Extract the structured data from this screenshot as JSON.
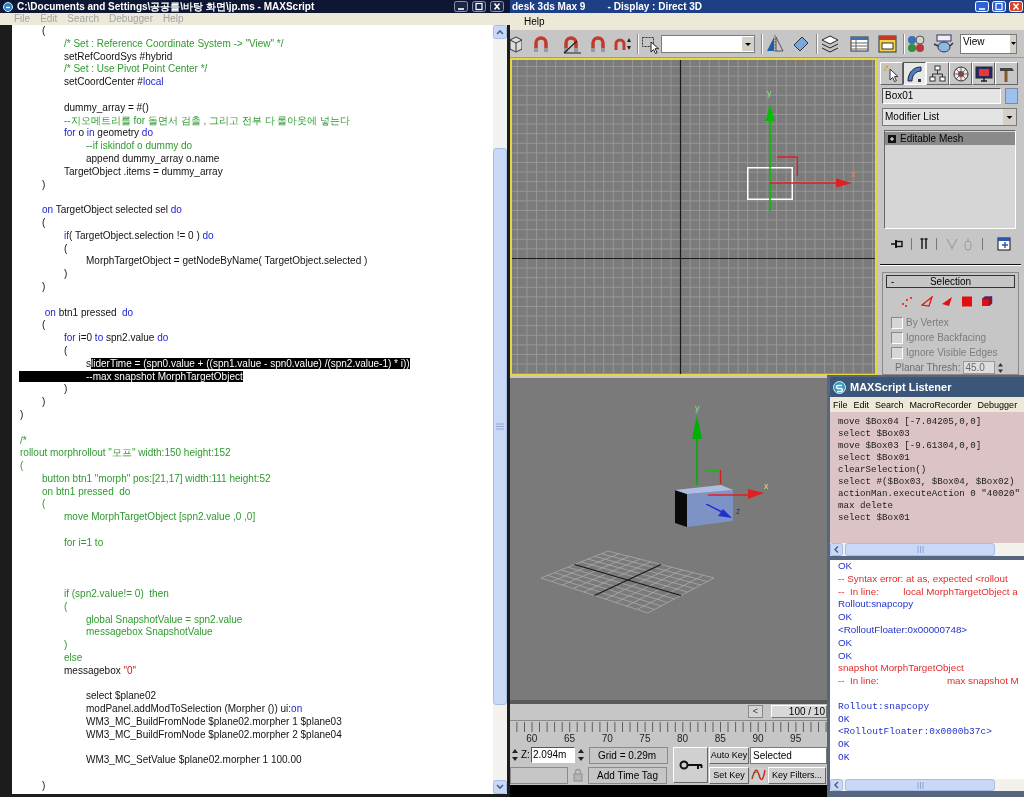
{
  "editor": {
    "title": "C:\\Documents and Settings\\공공를\\바탕 화면\\jp.ms - MAXScript",
    "menu": [
      {
        "label": "File",
        "disabled": true
      },
      {
        "label": "Edit",
        "disabled": true
      },
      {
        "label": "Search",
        "disabled": true
      },
      {
        "label": "Debugger",
        "disabled": true
      },
      {
        "label": "Help",
        "disabled": true
      }
    ],
    "lines": [
      {
        "kind": "code",
        "segments": [
          {
            "text": "\t(",
            "kind": "plain"
          }
        ]
      },
      {
        "kind": "code",
        "segments": [
          {
            "text": "\t\t/* Set : Reference Coordinate System -> \"View\" */",
            "kind": "comment"
          }
        ]
      },
      {
        "kind": "code",
        "segments": [
          {
            "text": "\t\tsetRefCoordSys #hybrid",
            "kind": "plain"
          }
        ]
      },
      {
        "kind": "code",
        "segments": [
          {
            "text": "\t\t/* Set : Use Pivot Point Center */",
            "kind": "comment"
          }
        ]
      },
      {
        "kind": "code",
        "segments": [
          {
            "text": "\t\tsetCoordCenter #",
            "kind": "plain"
          },
          {
            "text": "local",
            "kind": "keyword"
          }
        ]
      },
      {
        "kind": "blank"
      },
      {
        "kind": "code",
        "segments": [
          {
            "text": "\t\tdummy_array = #()",
            "kind": "plain"
          }
        ]
      },
      {
        "kind": "code",
        "segments": [
          {
            "text": "\t\t--지오메트리를 for 돌면서 검출 , 그리고 전부 다 롤아웃에 넣는다",
            "kind": "comment"
          }
        ]
      },
      {
        "kind": "code",
        "segments": [
          {
            "text": "\t\tfor",
            "kind": "keyword"
          },
          {
            "text": " o ",
            "kind": "plain"
          },
          {
            "text": "in",
            "kind": "keyword"
          },
          {
            "text": " geometry ",
            "kind": "plain"
          },
          {
            "text": "do",
            "kind": "keyword"
          }
        ]
      },
      {
        "kind": "code",
        "segments": [
          {
            "text": "\t\t\t--if iskindof o dummy do",
            "kind": "comment"
          }
        ]
      },
      {
        "kind": "code",
        "segments": [
          {
            "text": "\t\t\tappend dummy_array o.name",
            "kind": "plain"
          }
        ]
      },
      {
        "kind": "code",
        "segments": [
          {
            "text": "\t\tTargetObject .items = dummy_array",
            "kind": "plain"
          }
        ]
      },
      {
        "kind": "code",
        "segments": [
          {
            "text": "\t)",
            "kind": "plain"
          }
        ]
      },
      {
        "kind": "blank"
      },
      {
        "kind": "code",
        "segments": [
          {
            "text": "\ton",
            "kind": "keyword"
          },
          {
            "text": " TargetObject selected sel ",
            "kind": "plain"
          },
          {
            "text": "do",
            "kind": "keyword"
          }
        ]
      },
      {
        "kind": "code",
        "segments": [
          {
            "text": "\t(",
            "kind": "plain"
          }
        ]
      },
      {
        "kind": "code",
        "segments": [
          {
            "text": "\t\tif",
            "kind": "keyword"
          },
          {
            "text": "( TargetObject.selection != 0 ) ",
            "kind": "plain"
          },
          {
            "text": "do",
            "kind": "keyword"
          }
        ]
      },
      {
        "kind": "code",
        "segments": [
          {
            "text": "\t\t(",
            "kind": "plain"
          }
        ]
      },
      {
        "kind": "code",
        "segments": [
          {
            "text": "\t\t\tMorphTargetObject = getNodeByName( TargetObject.selected )",
            "kind": "plain"
          }
        ]
      },
      {
        "kind": "code",
        "segments": [
          {
            "text": "\t\t)",
            "kind": "plain"
          }
        ]
      },
      {
        "kind": "code",
        "segments": [
          {
            "text": "\t)",
            "kind": "plain"
          }
        ]
      },
      {
        "kind": "blank"
      },
      {
        "kind": "code",
        "segments": [
          {
            "text": "\t on",
            "kind": "keyword"
          },
          {
            "text": " btn1 pressed  ",
            "kind": "plain"
          },
          {
            "text": "do",
            "kind": "keyword"
          }
        ]
      },
      {
        "kind": "code",
        "segments": [
          {
            "text": "\t(",
            "kind": "plain"
          }
        ]
      },
      {
        "kind": "code",
        "segments": [
          {
            "text": "\t\tfor",
            "kind": "keyword"
          },
          {
            "text": " i=0 ",
            "kind": "plain"
          },
          {
            "text": "to",
            "kind": "keyword"
          },
          {
            "text": " spn2.value ",
            "kind": "plain"
          },
          {
            "text": "do",
            "kind": "keyword"
          }
        ]
      },
      {
        "kind": "code",
        "segments": [
          {
            "text": "\t\t(",
            "kind": "plain"
          }
        ]
      },
      {
        "kind": "code",
        "segments": [
          {
            "text": "\t\t\ts",
            "kind": "plain"
          },
          {
            "text": "liderTime = (spn0.value + ((spn1.value - spn0.value) /(spn2.value-1) * i))",
            "kind": "selection"
          }
        ]
      },
      {
        "kind": "code",
        "segments": [
          {
            "text": "\t\t\t--max snapshot MorphTargetObject",
            "kind": "selection"
          }
        ]
      },
      {
        "kind": "code",
        "segments": [
          {
            "text": "\t\t)",
            "kind": "plain"
          }
        ]
      },
      {
        "kind": "code",
        "segments": [
          {
            "text": "\t)",
            "kind": "plain"
          }
        ]
      },
      {
        "kind": "code",
        "segments": [
          {
            "text": ")",
            "kind": "plain"
          }
        ]
      },
      {
        "kind": "blank"
      },
      {
        "kind": "code",
        "segments": [
          {
            "text": "/*",
            "kind": "comment"
          }
        ]
      },
      {
        "kind": "code",
        "segments": [
          {
            "text": "rollout morphrollout \"모프\" width:150 height:152",
            "kind": "comment"
          }
        ]
      },
      {
        "kind": "code",
        "segments": [
          {
            "text": "(",
            "kind": "comment"
          }
        ]
      },
      {
        "kind": "code",
        "segments": [
          {
            "text": "\tbutton btn1 \"morph\" pos:[21,17] width:111 height:52",
            "kind": "comment"
          }
        ]
      },
      {
        "kind": "code",
        "segments": [
          {
            "text": "\ton btn1 pressed  do",
            "kind": "comment"
          }
        ]
      },
      {
        "kind": "code",
        "segments": [
          {
            "text": "\t(",
            "kind": "comment"
          }
        ]
      },
      {
        "kind": "code",
        "segments": [
          {
            "text": "\t\tmove MorphTargetObject [spn2.value ,0 ,0]",
            "kind": "comment"
          }
        ]
      },
      {
        "kind": "blank"
      },
      {
        "kind": "code",
        "segments": [
          {
            "text": "\t\tfor i=1 to",
            "kind": "comment"
          }
        ]
      },
      {
        "kind": "blank"
      },
      {
        "kind": "blank"
      },
      {
        "kind": "blank"
      },
      {
        "kind": "code",
        "segments": [
          {
            "text": "\t\tif (spn2.value!= 0)  then",
            "kind": "comment"
          }
        ]
      },
      {
        "kind": "code",
        "segments": [
          {
            "text": "\t\t(",
            "kind": "comment"
          }
        ]
      },
      {
        "kind": "code",
        "segments": [
          {
            "text": "\t\t\tglobal SnapshotValue = spn2.value",
            "kind": "comment"
          }
        ]
      },
      {
        "kind": "code",
        "segments": [
          {
            "text": "\t\t\tmessagebox SnapshotValue",
            "kind": "comment"
          }
        ]
      },
      {
        "kind": "code",
        "segments": [
          {
            "text": "\t\t)",
            "kind": "comment"
          }
        ]
      },
      {
        "kind": "code",
        "segments": [
          {
            "text": "\t\telse",
            "kind": "comment"
          }
        ]
      },
      {
        "kind": "code",
        "segments": [
          {
            "text": "\t\tmessagebox ",
            "kind": "plain"
          },
          {
            "text": "\"0\"",
            "kind": "string"
          }
        ]
      },
      {
        "kind": "blank"
      },
      {
        "kind": "code",
        "segments": [
          {
            "text": "\t\t\tselect $plane02",
            "kind": "plain"
          }
        ]
      },
      {
        "kind": "code",
        "segments": [
          {
            "text": "\t\t\tmodPanel.addModToSelection (Morpher ()) ui:",
            "kind": "plain"
          },
          {
            "text": "on",
            "kind": "keyword"
          }
        ]
      },
      {
        "kind": "code",
        "segments": [
          {
            "text": "\t\t\tWM3_MC_BuildFromNode $plane02.morpher 1 $plane03",
            "kind": "plain"
          }
        ]
      },
      {
        "kind": "code",
        "segments": [
          {
            "text": "\t\t\tWM3_MC_BuildFromNode $plane02.morpher 2 $plane04",
            "kind": "plain"
          }
        ]
      },
      {
        "kind": "blank"
      },
      {
        "kind": "code",
        "segments": [
          {
            "text": "\t\t\tWM3_MC_SetValue $plane02.morpher 1 100.00",
            "kind": "plain"
          }
        ]
      },
      {
        "kind": "blank"
      },
      {
        "kind": "code",
        "segments": [
          {
            "text": "\t)",
            "kind": "plain"
          }
        ]
      }
    ]
  },
  "app": {
    "title": "desk 3ds Max 9        - Display : Direct 3D",
    "menu": [
      {
        "label": "Help"
      }
    ],
    "toolbar": {
      "view_dropdown": "View"
    },
    "viewports": [
      {
        "kind": "top",
        "axis_labels": [
          "y",
          "x"
        ]
      },
      {
        "kind": "perspective",
        "axis_labels": [
          "y",
          "x",
          "z"
        ]
      }
    ],
    "command_panel": {
      "tabs": [
        {
          "selected": false
        },
        {
          "selected": true
        },
        {
          "selected": false
        },
        {
          "selected": false
        },
        {
          "selected": false
        },
        {
          "selected": false
        }
      ],
      "object_name": "Box01",
      "modifier_list": "Modifier List",
      "stack": [
        {
          "label": "Editable Mesh",
          "selected": true
        }
      ],
      "stack_tools": [
        {
          "disabled": false
        },
        {
          "disabled": false
        },
        {
          "disabled": true
        },
        {
          "disabled": true
        },
        {
          "disabled": false
        }
      ],
      "rollout": {
        "toggle": "-",
        "title": "Selection",
        "options": [
          {
            "label": "By Vertex",
            "checked": false,
            "disabled": true
          },
          {
            "label": "Ignore Backfacing",
            "checked": false,
            "disabled": true
          },
          {
            "label": "Ignore Visible Edges",
            "checked": false,
            "disabled": true
          }
        ],
        "planar_thresh": {
          "label": "Planar Thresh:",
          "value": "45.0",
          "disabled": true
        }
      }
    },
    "time_slider": {
      "back_button": "<",
      "position": "100 / 10"
    },
    "track_bar": {
      "labels": [
        "60",
        "65",
        "70",
        "75",
        "80",
        "85",
        "90",
        "95"
      ]
    },
    "status": {
      "coord_label": "Z:",
      "coord_value": "2.094m",
      "grid": "Grid = 0.29m",
      "time_tag": "Add Time Tag",
      "auto_key": "Auto Key",
      "key_mode": "Selected",
      "set_key": "Set Key",
      "key_filters": "Key Filters..."
    }
  },
  "listener": {
    "title": "MAXScript Listener",
    "menu": [
      {
        "label": "File"
      },
      {
        "label": "Edit"
      },
      {
        "label": "Search"
      },
      {
        "label": "MacroRecorder"
      },
      {
        "label": "Debugger"
      }
    ],
    "macro_lines": [
      "move $Box04 [-7.04205,0,0]",
      "select $Box03",
      "move $Box03 [-9.61304,0,0]",
      "select $Box01",
      "clearSelection()",
      "select #($Box03, $Box04, $Box02)",
      "actionMan.executeAction 0 \"40020\"",
      "max delete",
      "select $Box01"
    ],
    "output_lines": [
      {
        "text": "OK",
        "kind": "result"
      },
      {
        "text": "-- Syntax error: at as, expected <rollout",
        "kind": "error"
      },
      {
        "text": "--  In line:         local MorphTargetObject a",
        "kind": "error"
      },
      {
        "text": "Rollout:snapcopy",
        "kind": "result"
      },
      {
        "text": "OK",
        "kind": "result"
      },
      {
        "text": "<RolloutFloater:0x00000748>",
        "kind": "result"
      },
      {
        "text": "OK",
        "kind": "result"
      },
      {
        "text": "OK",
        "kind": "result"
      },
      {
        "text": "snapshot MorphTargetObject",
        "kind": "error"
      },
      {
        "text": "--  In line:                         max snapshot M",
        "kind": "error"
      },
      {
        "kind": "blank"
      },
      {
        "text": "Rollout:snapcopy",
        "kind": "echo"
      },
      {
        "text": "OK",
        "kind": "echo"
      },
      {
        "text": "<RolloutFloater:0x0000b37c>",
        "kind": "echo"
      },
      {
        "text": "OK",
        "kind": "echo"
      },
      {
        "text": "OK",
        "kind": "echo"
      }
    ]
  }
}
